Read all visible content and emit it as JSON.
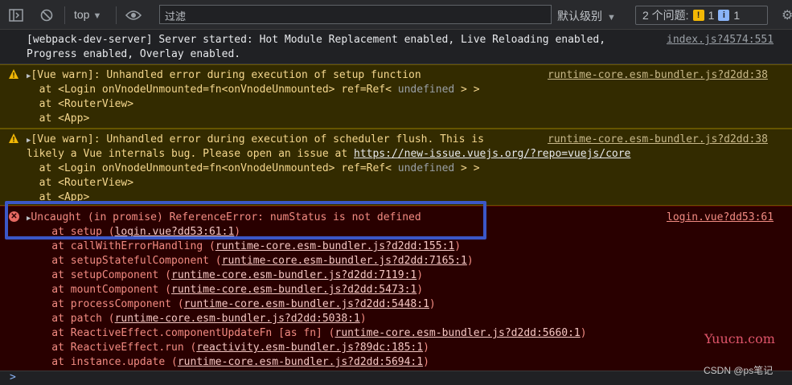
{
  "toolbar": {
    "context": "top",
    "filter_placeholder": "过滤",
    "levels": "默认级别",
    "issues_label": "2 个问题:",
    "warn_count": "1",
    "info_count": "1"
  },
  "messages": {
    "info": {
      "line1": "[webpack-dev-server] Server started: Hot Module Replacement enabled, Live Reloading enabled,",
      "line2": "Progress enabled, Overlay enabled.",
      "source": "index.js?4574:551"
    },
    "warn1": {
      "line1": "[Vue warn]: Unhandled error during execution of setup function",
      "line2_a": "  at <Login onVnodeUnmounted=fn<onVnodeUnmounted> ref=Ref< ",
      "line2_b": "undefined",
      "line2_c": " > >",
      "line3": "  at <RouterView>",
      "line4": "  at <App>",
      "source": "runtime-core.esm-bundler.js?d2dd:38"
    },
    "warn2": {
      "line1": "[Vue warn]: Unhandled error during execution of scheduler flush. This is",
      "line2_a": "likely a Vue internals bug. Please open an issue at ",
      "line2_link": "https://new-issue.vuejs.org/?repo=vuejs/core",
      "line3_a": "  at <Login onVnodeUnmounted=fn<onVnodeUnmounted> ref=Ref< ",
      "line3_b": "undefined",
      "line3_c": " > >",
      "line4": "  at <RouterView>",
      "line5": "  at <App>",
      "source": "runtime-core.esm-bundler.js?d2dd:38"
    },
    "error": {
      "line1": "Uncaught (in promise) ReferenceError: numStatus is not defined",
      "source": "login.vue?dd53:61",
      "stack": [
        {
          "fn": "    at setup (",
          "loc": "login.vue?dd53:61:1",
          "end": ")"
        },
        {
          "fn": "    at callWithErrorHandling (",
          "loc": "runtime-core.esm-bundler.js?d2dd:155:1",
          "end": ")"
        },
        {
          "fn": "    at setupStatefulComponent (",
          "loc": "runtime-core.esm-bundler.js?d2dd:7165:1",
          "end": ")"
        },
        {
          "fn": "    at setupComponent (",
          "loc": "runtime-core.esm-bundler.js?d2dd:7119:1",
          "end": ")"
        },
        {
          "fn": "    at mountComponent (",
          "loc": "runtime-core.esm-bundler.js?d2dd:5473:1",
          "end": ")"
        },
        {
          "fn": "    at processComponent (",
          "loc": "runtime-core.esm-bundler.js?d2dd:5448:1",
          "end": ")"
        },
        {
          "fn": "    at patch (",
          "loc": "runtime-core.esm-bundler.js?d2dd:5038:1",
          "end": ")"
        },
        {
          "fn": "    at ReactiveEffect.componentUpdateFn [as fn] (",
          "loc": "runtime-core.esm-bundler.js?d2dd:5660:1",
          "end": ")"
        },
        {
          "fn": "    at ReactiveEffect.run (",
          "loc": "reactivity.esm-bundler.js?89dc:185:1",
          "end": ")"
        },
        {
          "fn": "    at instance.update (",
          "loc": "runtime-core.esm-bundler.js?d2dd:5694:1",
          "end": ")"
        }
      ]
    }
  },
  "prompt": ">",
  "watermark": {
    "site": "Yuucn.com",
    "credit": "CSDN @ps笔记"
  }
}
